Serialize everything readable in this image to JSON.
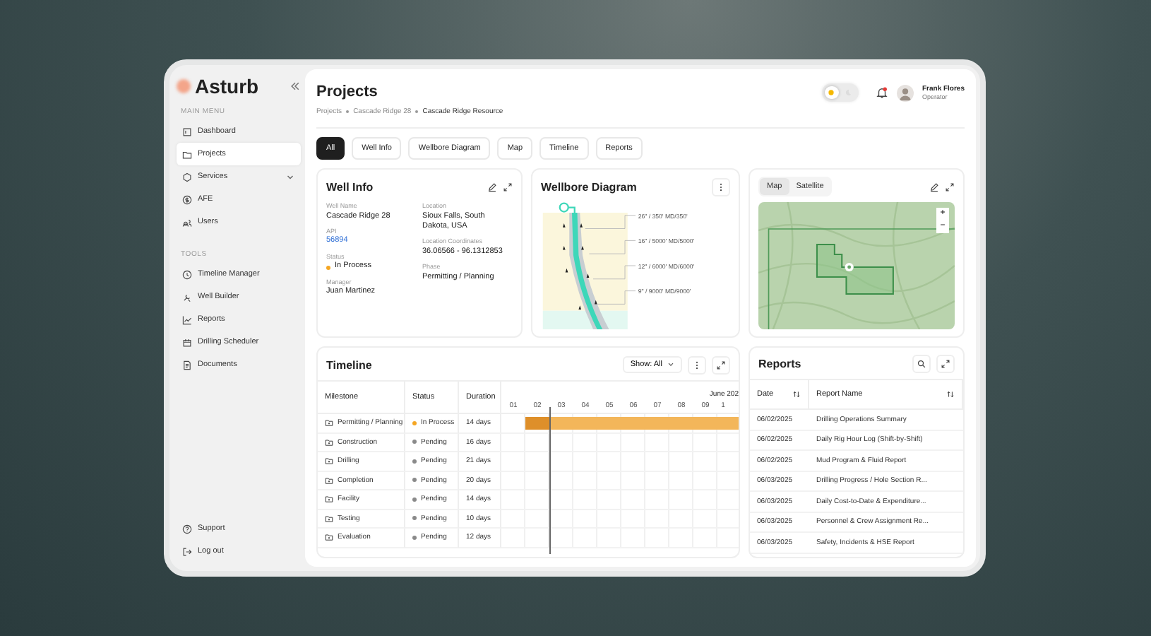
{
  "brand": {
    "name": "Asturb"
  },
  "sidebar": {
    "sections": [
      {
        "title": "MAIN MENU",
        "items": [
          {
            "label": "Dashboard",
            "kind": "link",
            "selected": false
          },
          {
            "label": "Projects",
            "kind": "link",
            "selected": true
          },
          {
            "label": "Services",
            "kind": "group",
            "expanded": false,
            "selected": false
          },
          {
            "label": "AFE",
            "kind": "link",
            "selected": false
          },
          {
            "label": "Users",
            "kind": "link",
            "selected": false
          }
        ]
      },
      {
        "title": "TOOLS",
        "items": [
          {
            "label": "Timeline Manager",
            "kind": "link",
            "selected": false
          },
          {
            "label": "Well Builder",
            "kind": "link",
            "selected": false
          },
          {
            "label": "Reports",
            "kind": "link",
            "selected": false
          },
          {
            "label": "Drilling Scheduler",
            "kind": "link",
            "selected": false
          },
          {
            "label": "Documents",
            "kind": "link",
            "selected": false
          }
        ]
      }
    ],
    "footer": [
      {
        "label": "Support"
      },
      {
        "label": "Log out"
      }
    ]
  },
  "header": {
    "title": "Projects",
    "breadcrumb": [
      "Projects",
      "Cascade Ridge 28",
      "Cascade Ridge Resource"
    ],
    "theme_toggle": [
      {
        "selected": true
      },
      {
        "selected": false
      }
    ],
    "notifications": {
      "unread": true
    },
    "user": {
      "name": "Frank Flores",
      "role": "Operator"
    }
  },
  "tabs": [
    {
      "label": "All",
      "selected": true
    },
    {
      "label": "Well Info",
      "selected": false
    },
    {
      "label": "Wellbore Diagram",
      "selected": false
    },
    {
      "label": "Map",
      "selected": false
    },
    {
      "label": "Timeline",
      "selected": false
    },
    {
      "label": "Reports",
      "selected": false
    }
  ],
  "well_info": {
    "title": "Well Info",
    "columns": [
      [
        {
          "label": "Well Name",
          "value": "Cascade Ridge 28",
          "kind": "text"
        },
        {
          "label": "API",
          "value": "56894",
          "kind": "link"
        },
        {
          "label": "Status",
          "value": "In Process",
          "kind": "status",
          "color": "#f5a623"
        },
        {
          "label": "Manager",
          "value": "Juan Martinez",
          "kind": "text"
        }
      ],
      [
        {
          "label": "Location",
          "value": "Sioux Falls, South Dakota, USA",
          "kind": "text"
        },
        {
          "label": "Location Coordinates",
          "value": "36.06566 - 96.1312853",
          "kind": "text"
        },
        {
          "label": "Phase",
          "value": "Permitting / Planning",
          "kind": "text"
        }
      ]
    ]
  },
  "wellbore": {
    "title": "Wellbore Diagram",
    "casings": [
      "26\" / 350' MD/350'",
      "16\" / 5000' MD/5000'",
      "12\" / 6000' MD/6000'",
      "9\" / 9000' MD/9000'"
    ]
  },
  "map": {
    "tabs": [
      {
        "label": "Map",
        "selected": true
      },
      {
        "label": "Satellite",
        "selected": false
      }
    ],
    "zoom": [
      "+",
      "−"
    ]
  },
  "timeline": {
    "title": "Timeline",
    "filter": "Show: All",
    "columns": [
      "Milestone",
      "Status",
      "Duration"
    ],
    "month": "June 202",
    "days": [
      "01",
      "02",
      "03",
      "04",
      "05",
      "06",
      "07",
      "08",
      "09",
      "1"
    ],
    "rows": [
      {
        "milestone": "Permitting / Planning",
        "status": "In Process",
        "color": "#f5a623",
        "duration": "14 days",
        "bar": {
          "level": 0.12
        }
      },
      {
        "milestone": "Construction",
        "status": "Pending",
        "color": "#8a8a8a",
        "duration": "16 days"
      },
      {
        "milestone": "Drilling",
        "status": "Pending",
        "color": "#8a8a8a",
        "duration": "21 days"
      },
      {
        "milestone": "Completion",
        "status": "Pending",
        "color": "#8a8a8a",
        "duration": "20 days"
      },
      {
        "milestone": "Facility",
        "status": "Pending",
        "color": "#8a8a8a",
        "duration": "14 days"
      },
      {
        "milestone": "Testing",
        "status": "Pending",
        "color": "#8a8a8a",
        "duration": "10 days"
      },
      {
        "milestone": "Evaluation",
        "status": "Pending",
        "color": "#8a8a8a",
        "duration": "12 days"
      }
    ]
  },
  "reports": {
    "title": "Reports",
    "columns": [
      "Date",
      "Report Name"
    ],
    "rows": [
      {
        "date": "06/02/2025",
        "name": "Drilling Operations Summary"
      },
      {
        "date": "06/02/2025",
        "name": "Daily Rig Hour Log (Shift-by-Shift)"
      },
      {
        "date": "06/02/2025",
        "name": "Mud Program & Fluid Report"
      },
      {
        "date": "06/03/2025",
        "name": "Drilling Progress / Hole Section R..."
      },
      {
        "date": "06/03/2025",
        "name": "Daily Cost-to-Date & Expenditure..."
      },
      {
        "date": "06/03/2025",
        "name": "Personnel & Crew Assignment Re..."
      },
      {
        "date": "06/03/2025",
        "name": "Safety, Incidents & HSE Report"
      }
    ]
  }
}
